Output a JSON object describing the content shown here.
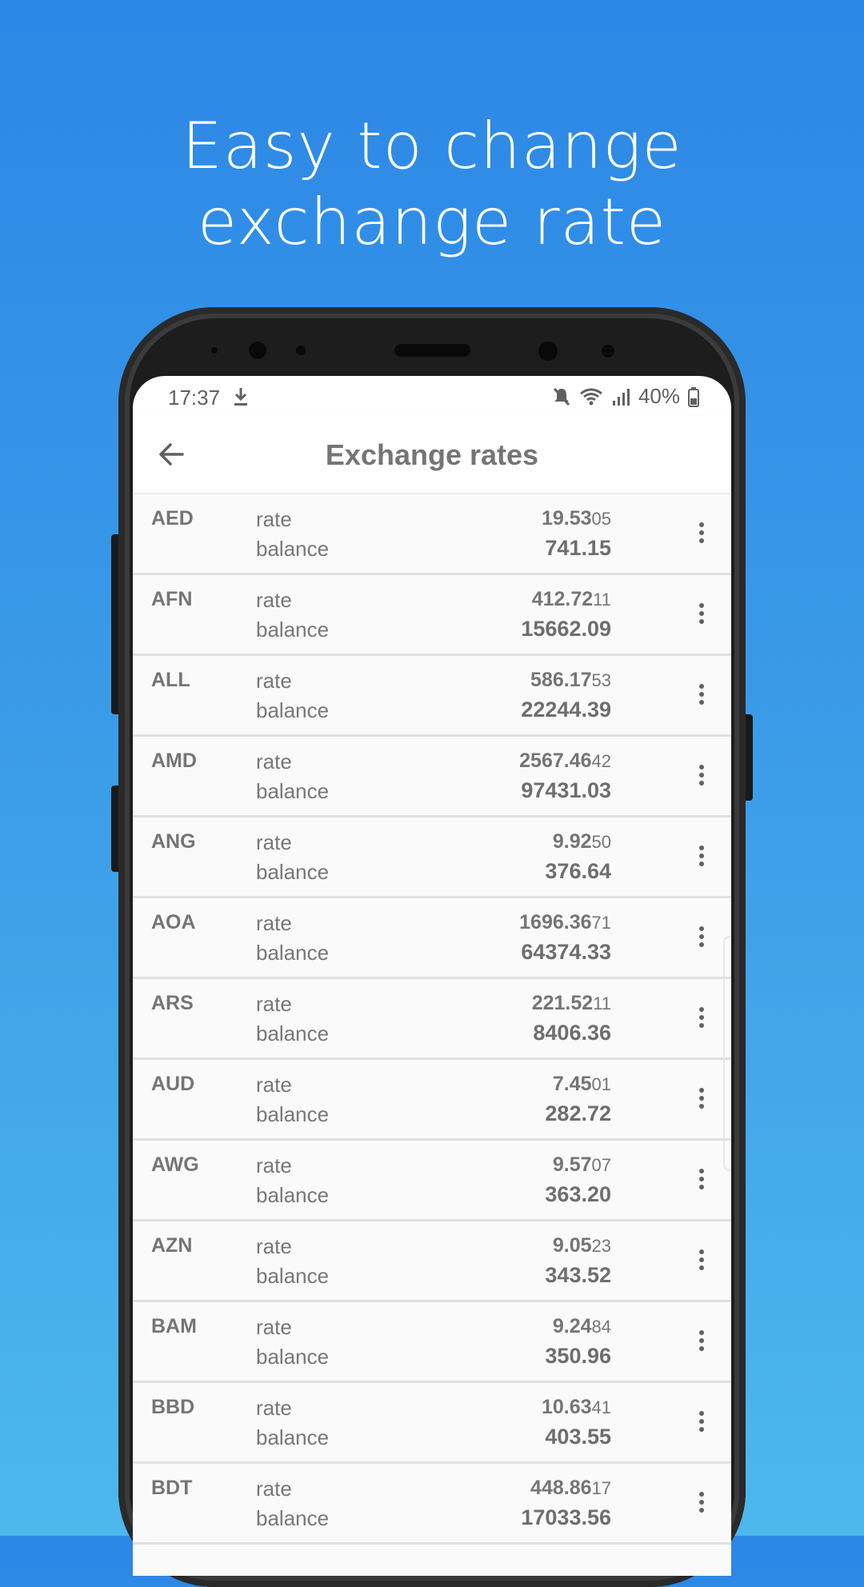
{
  "headline": [
    "Easy to change",
    "exchange rate"
  ],
  "status": {
    "time": "17:37",
    "battery": "40%"
  },
  "appbar": {
    "title": "Exchange rates"
  },
  "labels": {
    "rate": "rate",
    "balance": "balance"
  },
  "rows": [
    {
      "code": "AED",
      "rate_main": "19.53",
      "rate_sub": "05",
      "balance": "741.15"
    },
    {
      "code": "AFN",
      "rate_main": "412.72",
      "rate_sub": "11",
      "balance": "15662.09"
    },
    {
      "code": "ALL",
      "rate_main": "586.17",
      "rate_sub": "53",
      "balance": "22244.39"
    },
    {
      "code": "AMD",
      "rate_main": "2567.46",
      "rate_sub": "42",
      "balance": "97431.03"
    },
    {
      "code": "ANG",
      "rate_main": "9.92",
      "rate_sub": "50",
      "balance": "376.64"
    },
    {
      "code": "AOA",
      "rate_main": "1696.36",
      "rate_sub": "71",
      "balance": "64374.33"
    },
    {
      "code": "ARS",
      "rate_main": "221.52",
      "rate_sub": "11",
      "balance": "8406.36"
    },
    {
      "code": "AUD",
      "rate_main": "7.45",
      "rate_sub": "01",
      "balance": "282.72"
    },
    {
      "code": "AWG",
      "rate_main": "9.57",
      "rate_sub": "07",
      "balance": "363.20"
    },
    {
      "code": "AZN",
      "rate_main": "9.05",
      "rate_sub": "23",
      "balance": "343.52"
    },
    {
      "code": "BAM",
      "rate_main": "9.24",
      "rate_sub": "84",
      "balance": "350.96"
    },
    {
      "code": "BBD",
      "rate_main": "10.63",
      "rate_sub": "41",
      "balance": "403.55"
    },
    {
      "code": "BDT",
      "rate_main": "448.86",
      "rate_sub": "17",
      "balance": "17033.56"
    }
  ],
  "icons": {
    "back": "arrow-left-icon",
    "more": "more-vertical-icon",
    "download": "download-icon",
    "mute": "mute-icon",
    "wifi": "wifi-icon",
    "signal": "signal-icon",
    "battery": "battery-icon"
  }
}
